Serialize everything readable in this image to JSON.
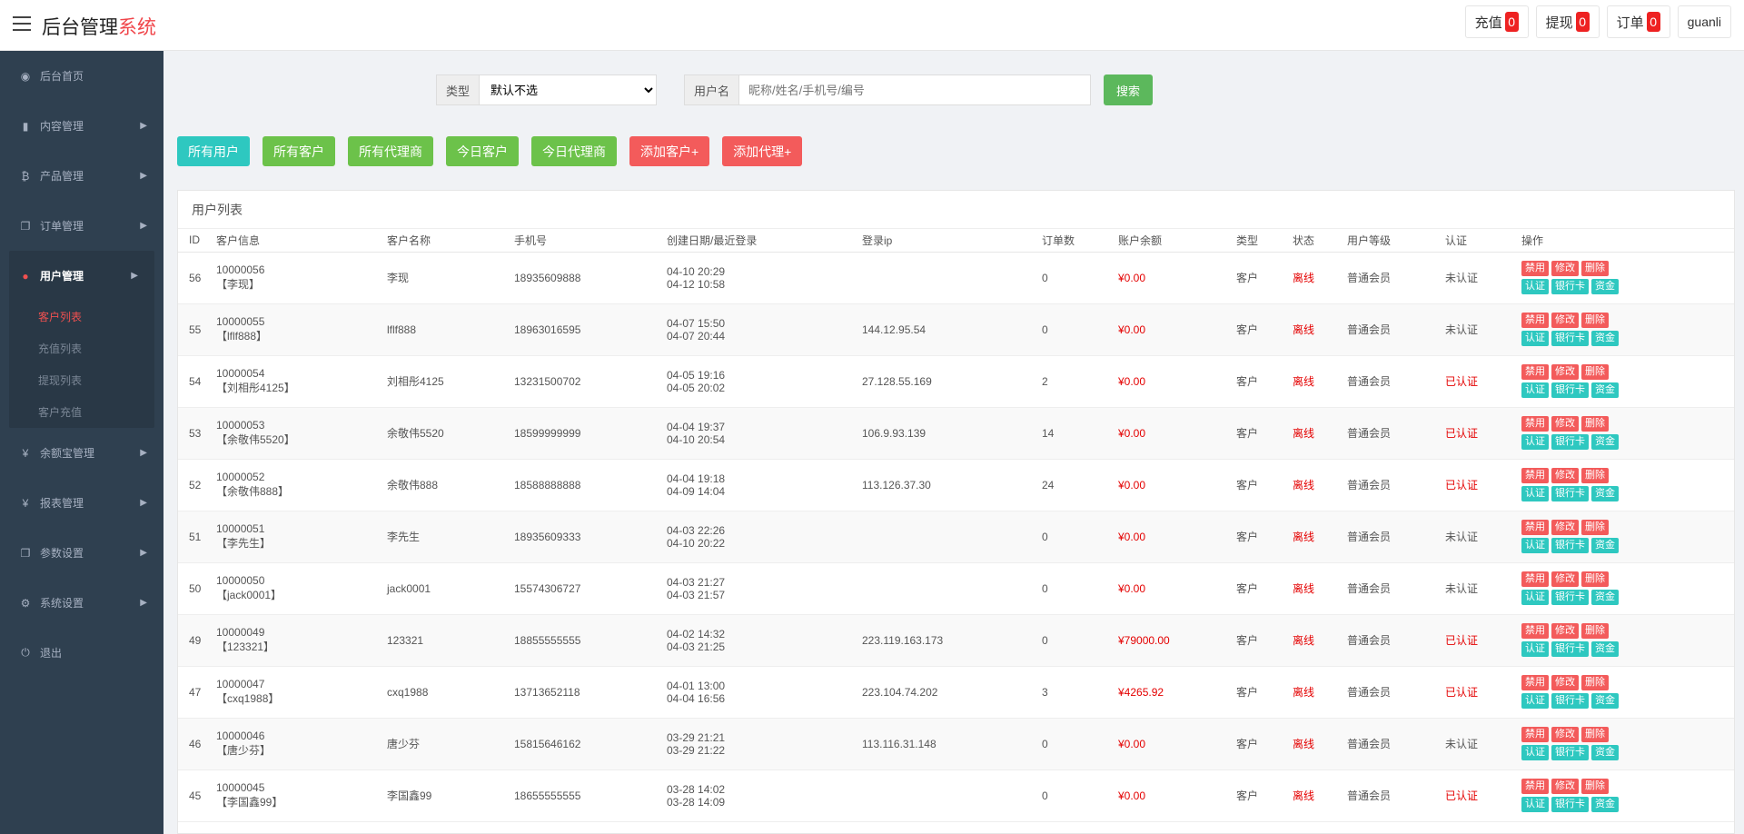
{
  "topbar": {
    "brand_main": "后台管理",
    "brand_accent": "系统",
    "actions": [
      {
        "label": "充值",
        "count": "0"
      },
      {
        "label": "提现",
        "count": "0"
      },
      {
        "label": "订单",
        "count": "0"
      }
    ],
    "user": "guanli"
  },
  "sidebar": {
    "items": [
      {
        "label": "后台首页",
        "icon": "dashboard-icon",
        "glyph": "◉"
      },
      {
        "label": "内容管理",
        "icon": "book-icon",
        "glyph": "▮"
      },
      {
        "label": "产品管理",
        "icon": "bitcoin-icon",
        "glyph": "₿"
      },
      {
        "label": "订单管理",
        "icon": "copy-icon",
        "glyph": "❐"
      }
    ],
    "active_group": {
      "label": "用户管理",
      "icon": "user-icon",
      "glyph": "●"
    },
    "sub_items": [
      "客户列表",
      "充值列表",
      "提现列表",
      "客户充值"
    ],
    "items_after": [
      {
        "label": "余额宝管理",
        "icon": "yen-icon",
        "glyph": "¥"
      },
      {
        "label": "报表管理",
        "icon": "yen-icon",
        "glyph": "¥"
      },
      {
        "label": "参数设置",
        "icon": "copy-icon",
        "glyph": "❐"
      },
      {
        "label": "系统设置",
        "icon": "gears-icon",
        "glyph": "⚙"
      },
      {
        "label": "退出",
        "icon": "logout-icon",
        "glyph": "⏻"
      }
    ]
  },
  "filter": {
    "type_label": "类型",
    "type_selected": "默认不选",
    "user_label": "用户名",
    "user_placeholder": "昵称/姓名/手机号/编号",
    "search_label": "搜索"
  },
  "quick_buttons": [
    {
      "label": "所有用户",
      "color": "teal"
    },
    {
      "label": "所有客户",
      "color": "green"
    },
    {
      "label": "所有代理商",
      "color": "green"
    },
    {
      "label": "今日客户",
      "color": "green"
    },
    {
      "label": "今日代理商",
      "color": "green"
    },
    {
      "label": "添加客户+",
      "color": "red"
    },
    {
      "label": "添加代理+",
      "color": "red"
    }
  ],
  "panel_title": "用户列表",
  "table": {
    "headers": [
      "ID",
      "客户信息",
      "客户名称",
      "手机号",
      "创建日期/最近登录",
      "登录ip",
      "订单数",
      "账户余额",
      "类型",
      "状态",
      "用户等级",
      "认证",
      "操作"
    ],
    "op_labels": {
      "ban": "禁用",
      "edit": "修改",
      "delete": "删除",
      "verify": "认证",
      "bank": "银行卡",
      "funds": "资金"
    },
    "rows": [
      {
        "id": "56",
        "code": "10000056",
        "info": "【李现】",
        "name": "李现",
        "phone": "18935609888",
        "created": "04-10 20:29",
        "last": "04-12 10:58",
        "ip": "",
        "orders": "0",
        "balance": "¥0.00",
        "type": "客户",
        "status": "离线",
        "level": "普通会员",
        "auth": "未认证"
      },
      {
        "id": "55",
        "code": "10000055",
        "info": "【lflf888】",
        "name": "lflf888",
        "phone": "18963016595",
        "created": "04-07 15:50",
        "last": "04-07 20:44",
        "ip": "144.12.95.54",
        "orders": "0",
        "balance": "¥0.00",
        "type": "客户",
        "status": "离线",
        "level": "普通会员",
        "auth": "未认证"
      },
      {
        "id": "54",
        "code": "10000054",
        "info": "【刘相彤4125】",
        "name": "刘相彤4125",
        "phone": "13231500702",
        "created": "04-05 19:16",
        "last": "04-05 20:02",
        "ip": "27.128.55.169",
        "orders": "2",
        "balance": "¥0.00",
        "type": "客户",
        "status": "离线",
        "level": "普通会员",
        "auth": "已认证"
      },
      {
        "id": "53",
        "code": "10000053",
        "info": "【余敬伟5520】",
        "name": "余敬伟5520",
        "phone": "18599999999",
        "created": "04-04 19:37",
        "last": "04-10 20:54",
        "ip": "106.9.93.139",
        "orders": "14",
        "balance": "¥0.00",
        "type": "客户",
        "status": "离线",
        "level": "普通会员",
        "auth": "已认证"
      },
      {
        "id": "52",
        "code": "10000052",
        "info": "【余敬伟888】",
        "name": "余敬伟888",
        "phone": "18588888888",
        "created": "04-04 19:18",
        "last": "04-09 14:04",
        "ip": "113.126.37.30",
        "orders": "24",
        "balance": "¥0.00",
        "type": "客户",
        "status": "离线",
        "level": "普通会员",
        "auth": "已认证"
      },
      {
        "id": "51",
        "code": "10000051",
        "info": "【李先生】",
        "name": "李先生",
        "phone": "18935609333",
        "created": "04-03 22:26",
        "last": "04-10 20:22",
        "ip": "",
        "orders": "0",
        "balance": "¥0.00",
        "type": "客户",
        "status": "离线",
        "level": "普通会员",
        "auth": "未认证"
      },
      {
        "id": "50",
        "code": "10000050",
        "info": "【jack0001】",
        "name": "jack0001",
        "phone": "15574306727",
        "created": "04-03 21:27",
        "last": "04-03 21:57",
        "ip": "",
        "orders": "0",
        "balance": "¥0.00",
        "type": "客户",
        "status": "离线",
        "level": "普通会员",
        "auth": "未认证"
      },
      {
        "id": "49",
        "code": "10000049",
        "info": "【123321】",
        "name": "123321",
        "phone": "18855555555",
        "created": "04-02 14:32",
        "last": "04-03 21:25",
        "ip": "223.119.163.173",
        "orders": "0",
        "balance": "¥79000.00",
        "type": "客户",
        "status": "离线",
        "level": "普通会员",
        "auth": "已认证"
      },
      {
        "id": "47",
        "code": "10000047",
        "info": "【cxq1988】",
        "name": "cxq1988",
        "phone": "13713652118",
        "created": "04-01 13:00",
        "last": "04-04 16:56",
        "ip": "223.104.74.202",
        "orders": "3",
        "balance": "¥4265.92",
        "type": "客户",
        "status": "离线",
        "level": "普通会员",
        "auth": "已认证"
      },
      {
        "id": "46",
        "code": "10000046",
        "info": "【唐少芬】",
        "name": "唐少芬",
        "phone": "15815646162",
        "created": "03-29 21:21",
        "last": "03-29 21:22",
        "ip": "113.116.31.148",
        "orders": "0",
        "balance": "¥0.00",
        "type": "客户",
        "status": "离线",
        "level": "普通会员",
        "auth": "未认证"
      },
      {
        "id": "45",
        "code": "10000045",
        "info": "【李国鑫99】",
        "name": "李国鑫99",
        "phone": "18655555555",
        "created": "03-28 14:02",
        "last": "03-28 14:09",
        "ip": "",
        "orders": "0",
        "balance": "¥0.00",
        "type": "客户",
        "status": "离线",
        "level": "普通会员",
        "auth": "已认证"
      }
    ]
  },
  "colors": {
    "accent_red": "#f0454a",
    "sidebar_bg": "#2f4050",
    "money_red": "#e40000",
    "teal": "#2ec8c0",
    "green": "#6cc24a"
  }
}
